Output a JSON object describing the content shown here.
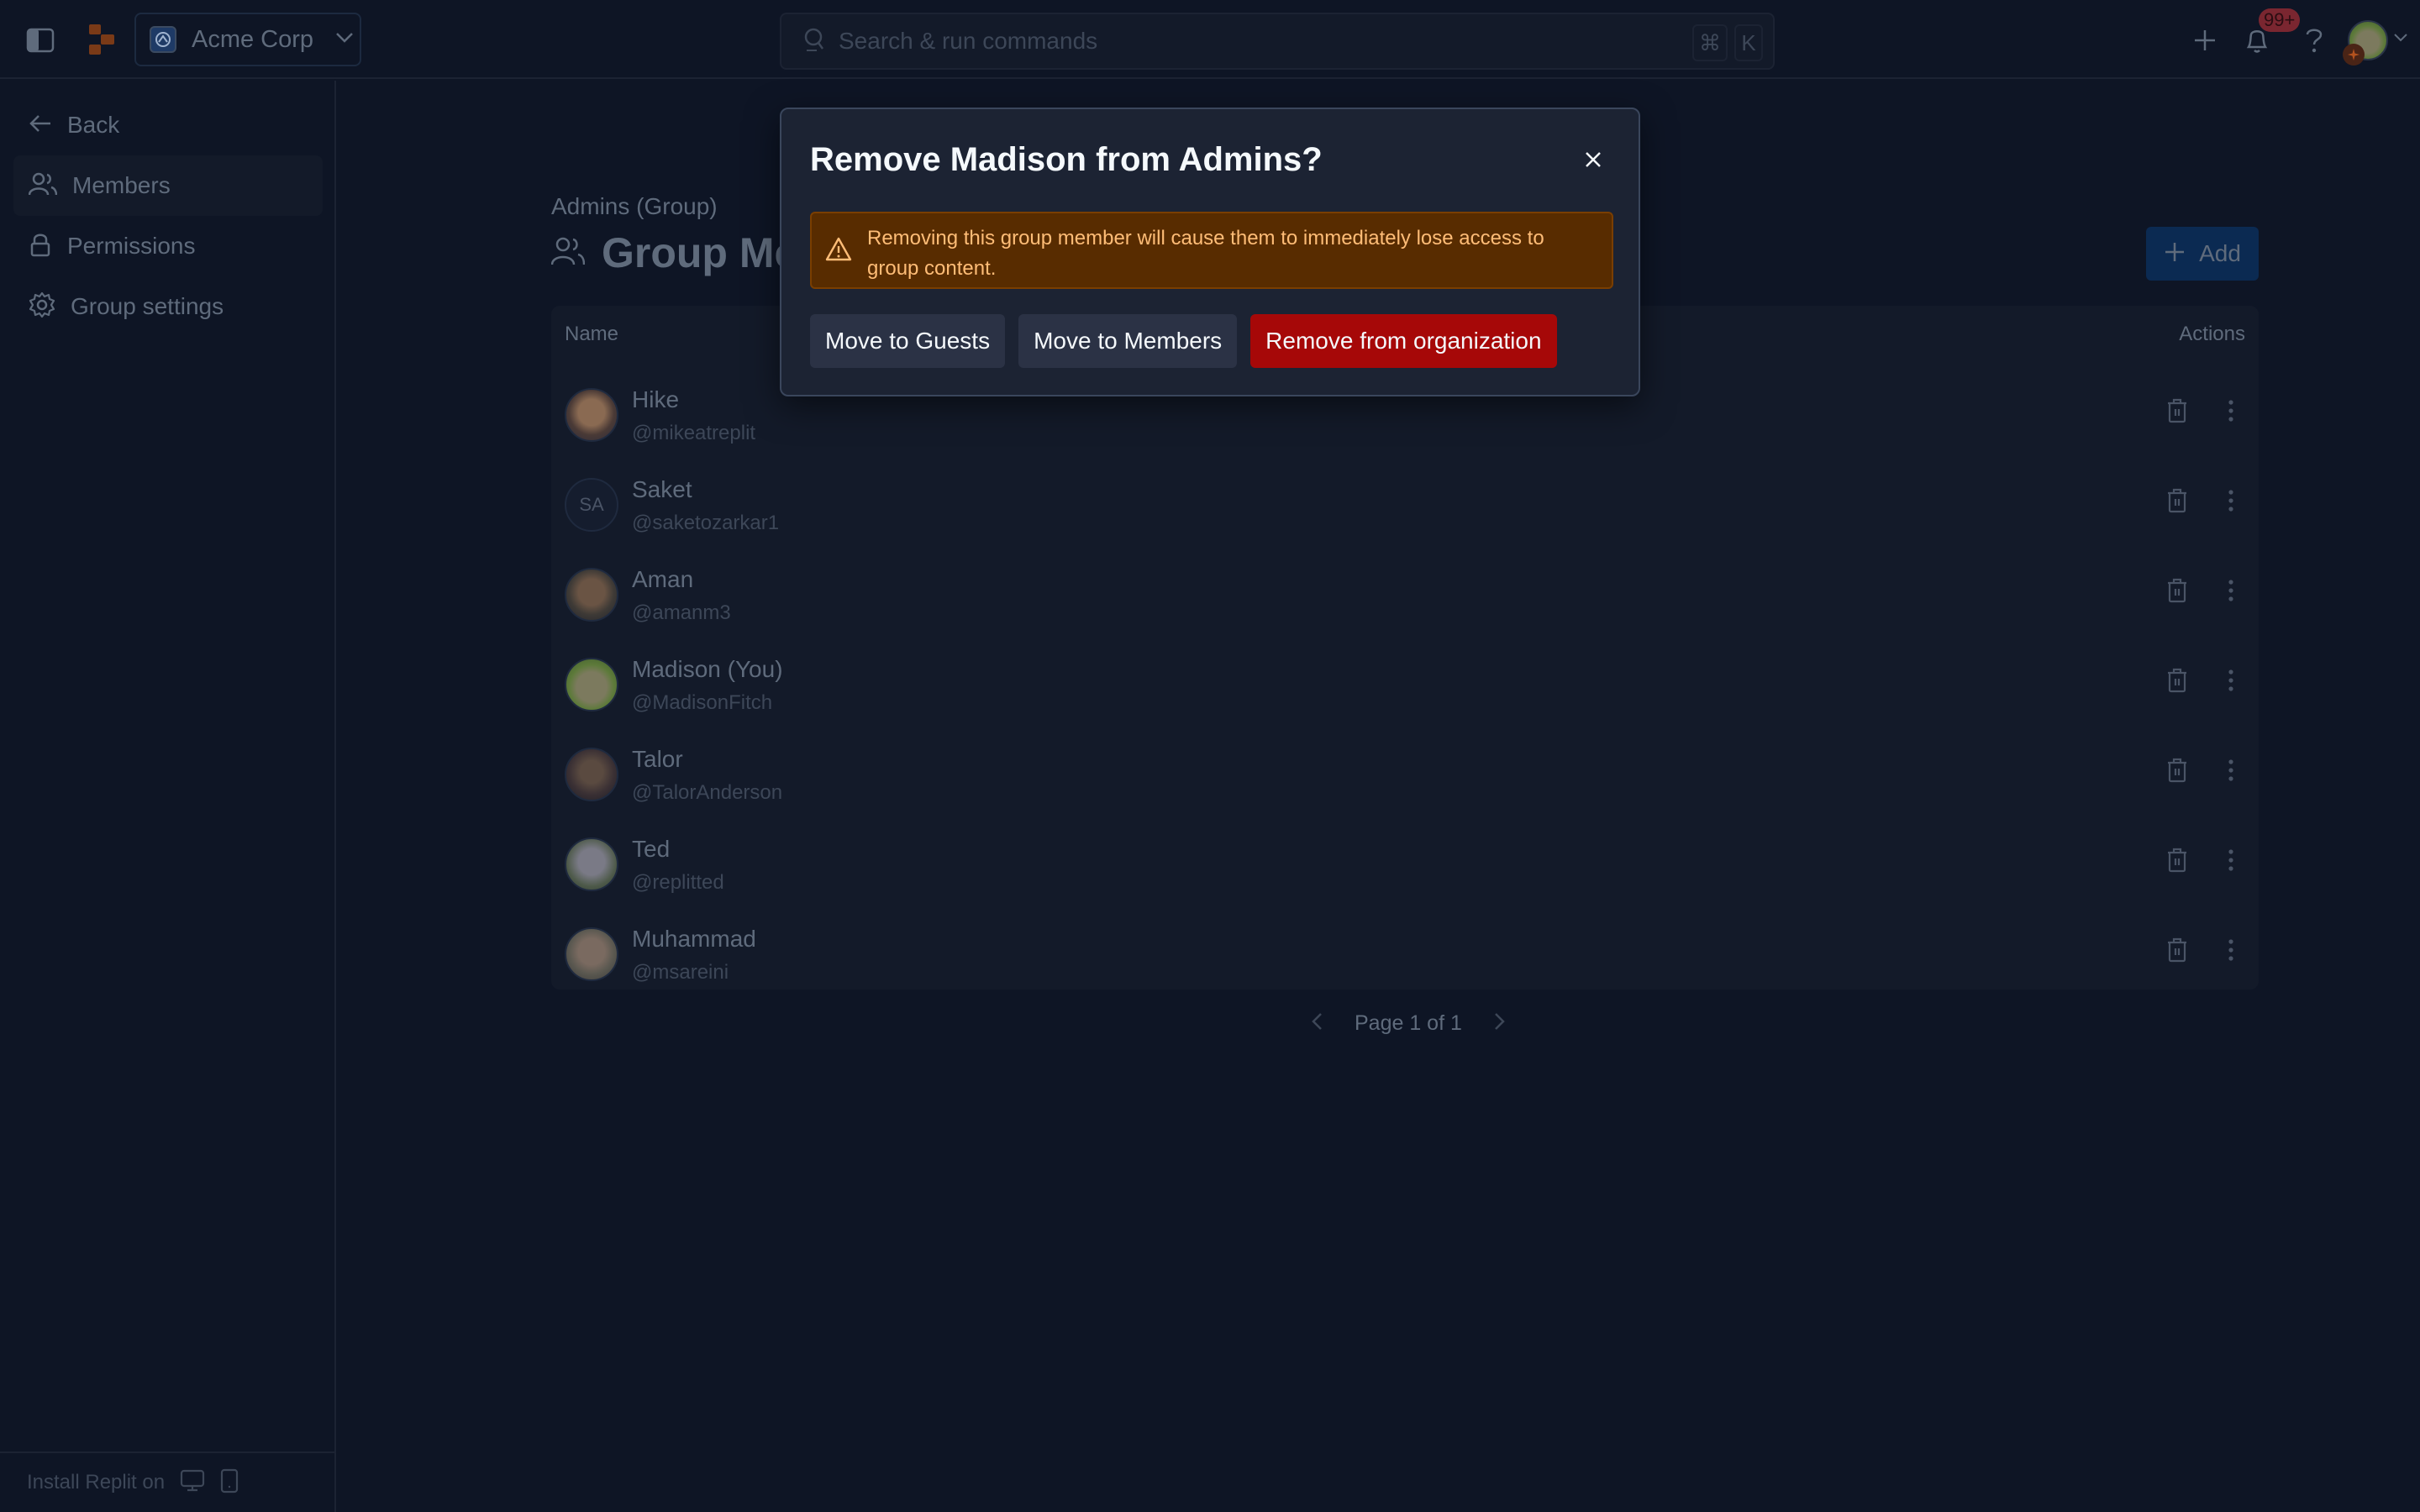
{
  "topbar": {
    "org_name": "Acme Corp",
    "search_placeholder": "Search & run commands",
    "shortcut_keys": [
      "⌘",
      "K"
    ],
    "notification_badge": "99+"
  },
  "sidebar": {
    "items": [
      {
        "label": "Back",
        "icon": "arrow-left-icon",
        "active": false
      },
      {
        "label": "Members",
        "icon": "users-icon",
        "active": true
      },
      {
        "label": "Permissions",
        "icon": "lock-icon",
        "active": false
      },
      {
        "label": "Group settings",
        "icon": "gear-icon",
        "active": false
      }
    ],
    "footer_text": "Install Replit on"
  },
  "main": {
    "breadcrumb": "Admins (Group)",
    "title": "Group Members",
    "add_label": "Add",
    "table": {
      "columns": [
        "Name",
        "Actions"
      ],
      "rows": [
        {
          "name": "Hike",
          "handle": "@mikeatreplit",
          "avatar": "photo",
          "initials": ""
        },
        {
          "name": "Saket",
          "handle": "@saketozarkar1",
          "avatar": "initials",
          "initials": "SA"
        },
        {
          "name": "Aman",
          "handle": "@amanm3",
          "avatar": "photo",
          "initials": ""
        },
        {
          "name": "Madison (You)",
          "handle": "@MadisonFitch",
          "avatar": "photo",
          "initials": ""
        },
        {
          "name": "Talor",
          "handle": "@TalorAnderson",
          "avatar": "photo",
          "initials": ""
        },
        {
          "name": "Ted",
          "handle": "@replitted",
          "avatar": "photo",
          "initials": ""
        },
        {
          "name": "Muhammad",
          "handle": "@msareini",
          "avatar": "photo",
          "initials": ""
        }
      ]
    },
    "pagination": "Page 1 of 1"
  },
  "modal": {
    "title": "Remove Madison from Admins?",
    "warning": "Removing this group member will cause them to immediately lose access to group content.",
    "buttons": {
      "guests": "Move to Guests",
      "members": "Move to Members",
      "remove": "Remove from organization"
    }
  },
  "colors": {
    "background": "#0e1525",
    "modal": "#1c2333",
    "danger": "#a60808",
    "warning_bg": "#582c00",
    "warning_text": "#ffbd77",
    "accent_dim": "#0b2a52"
  }
}
